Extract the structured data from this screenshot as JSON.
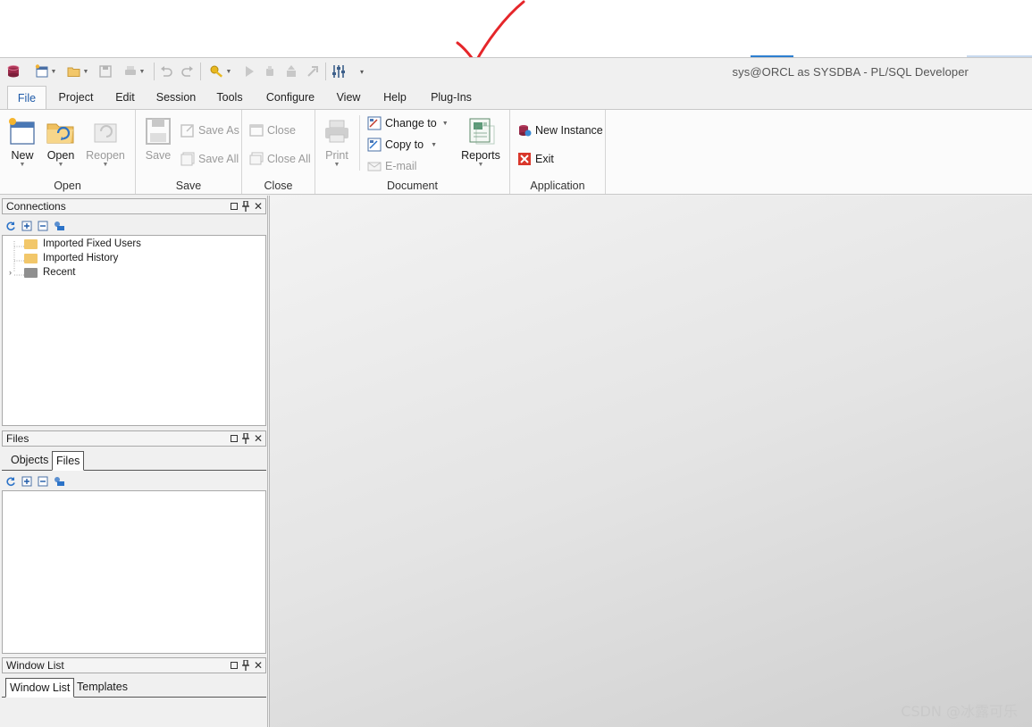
{
  "window": {
    "title": "sys@ORCL as SYSDBA - PL/SQL Developer"
  },
  "ribbon_tabs": [
    "File",
    "Project",
    "Edit",
    "Session",
    "Tools",
    "Configure",
    "View",
    "Help",
    "Plug-Ins"
  ],
  "active_tab": "File",
  "groups": {
    "open": {
      "label": "Open",
      "new": "New",
      "open": "Open",
      "reopen": "Reopen"
    },
    "save": {
      "label": "Save",
      "save": "Save",
      "save_as": "Save As",
      "save_all": "Save All"
    },
    "close": {
      "label": "Close",
      "close": "Close",
      "close_all": "Close All"
    },
    "document": {
      "label": "Document",
      "print": "Print",
      "change_to": "Change to",
      "copy_to": "Copy to",
      "email": "E-mail",
      "reports": "Reports"
    },
    "application": {
      "label": "Application",
      "new_instance": "New Instance",
      "exit": "Exit"
    }
  },
  "connections_panel": {
    "title": "Connections",
    "items": [
      "Imported Fixed Users",
      "Imported History",
      "Recent"
    ]
  },
  "files_panel": {
    "title": "Files",
    "tabs": [
      "Objects",
      "Files"
    ],
    "active_tab": "Files"
  },
  "window_list_panel": {
    "title": "Window List",
    "tabs": [
      "Window List",
      "Templates"
    ],
    "active_tab": "Window List"
  },
  "watermark": "CSDN @冰露可乐",
  "colors": {
    "accent": "#1e5aa8",
    "annotation_check": "#e5262a",
    "folder": "#f2c76a",
    "folder_recent": "#8f8f8f"
  }
}
